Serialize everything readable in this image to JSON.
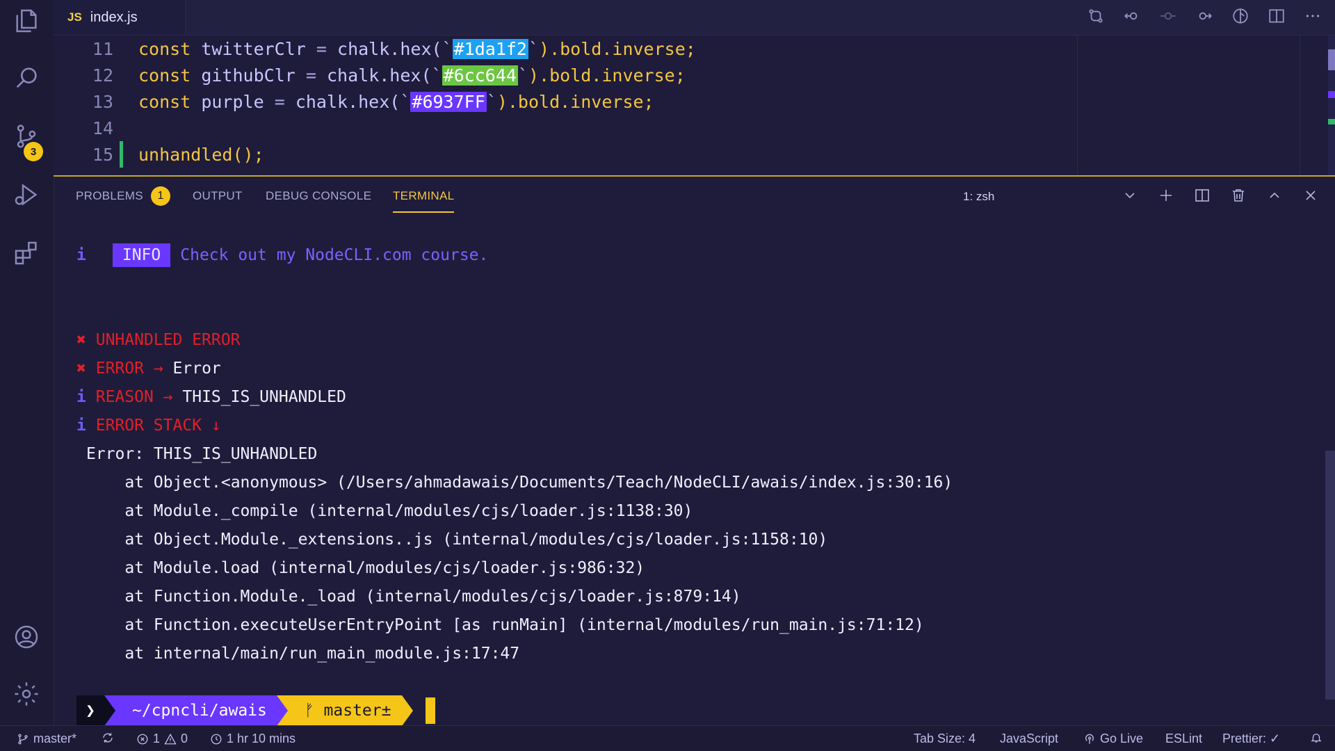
{
  "tab": {
    "icon": "JS",
    "filename": "index.js"
  },
  "editor": {
    "lines": [
      {
        "num": "11",
        "kw": "const",
        "var": "twitterClr",
        "eq": "=",
        "call": "chalk.hex(",
        "hex": "#1da1f2",
        "rest": ").bold.inverse;"
      },
      {
        "num": "12",
        "kw": "const",
        "var": "githubClr",
        "eq": "=",
        "call": "chalk.hex(",
        "hex": "#6cc644",
        "rest": ").bold.inverse;"
      },
      {
        "num": "13",
        "kw": "const",
        "var": "purple",
        "eq": "=",
        "call": "chalk.hex(",
        "hex": "#6937FF",
        "rest": ").bold.inverse;"
      },
      {
        "num": "14"
      },
      {
        "num": "15",
        "code": "unhandled();"
      }
    ],
    "backtick": "`"
  },
  "panel": {
    "tabs": [
      "PROBLEMS",
      "OUTPUT",
      "DEBUG CONSOLE",
      "TERMINAL"
    ],
    "problems_count": "1",
    "terminal_name": "1: zsh"
  },
  "terminal": {
    "info_icon": "i",
    "info_label": "INFO",
    "info_message": "Check out my NodeCLI.com course.",
    "cross": "✖",
    "arrow": "→",
    "down_arrow": "↓",
    "unhandled_title": "UNHANDLED ERROR",
    "error_label": "ERROR",
    "error_value": "Error",
    "reason_label": "REASON",
    "reason_value": "THIS_IS_UNHANDLED",
    "stack_label": "ERROR STACK",
    "stack": [
      "Error: THIS_IS_UNHANDLED",
      "    at Object.<anonymous> (/Users/ahmadawais/Documents/Teach/NodeCLI/awais/index.js:30:16)",
      "    at Module._compile (internal/modules/cjs/loader.js:1138:30)",
      "    at Object.Module._extensions..js (internal/modules/cjs/loader.js:1158:10)",
      "    at Module.load (internal/modules/cjs/loader.js:986:32)",
      "    at Function.Module._load (internal/modules/cjs/loader.js:879:14)",
      "    at Function.executeUserEntryPoint [as runMain] (internal/modules/run_main.js:71:12)",
      "    at internal/main/run_main_module.js:17:47"
    ],
    "prompt": {
      "chevron": "❯",
      "path": "~/cpncli/awais",
      "branch_icon": "ᚠ",
      "branch": "master±"
    }
  },
  "statusbar": {
    "branch": "master*",
    "errors": "1",
    "warnings": "0",
    "time": "1 hr 10 mins",
    "tab_size": "Tab Size: 4",
    "language": "JavaScript",
    "go_live": "Go Live",
    "eslint": "ESLint",
    "prettier": "Prettier: ✓"
  },
  "activity": {
    "scm_badge": "3"
  },
  "colors": {
    "twitter": "#1da1f2",
    "github": "#6cc644",
    "purple": "#6937ff",
    "accent_yellow": "#f5c518",
    "error_red": "#e0202a"
  }
}
